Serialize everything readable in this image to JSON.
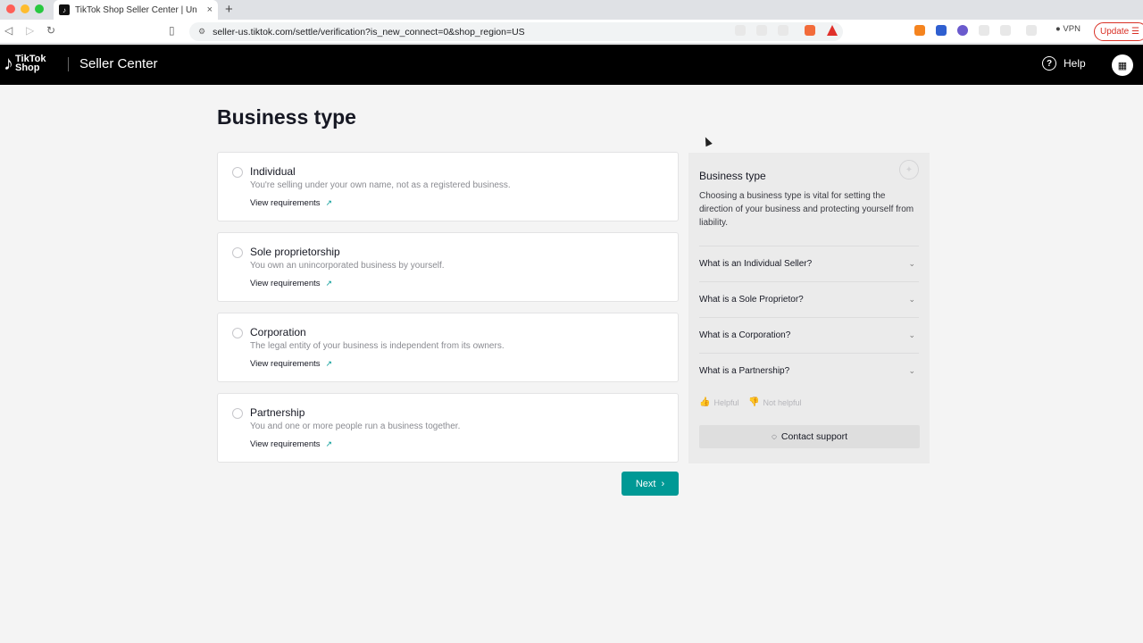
{
  "browser": {
    "tab_title": "TikTok Shop Seller Center | Un",
    "tab_close": "×",
    "new_tab": "+",
    "url": "seller-us.tiktok.com/settle/verification?is_new_connect=0&shop_region=US",
    "vpn_label": "VPN",
    "update_label": "Update",
    "favicon": "♪",
    "back_icon": "◁",
    "forward_icon": "▷",
    "reload_icon": "↻",
    "bookmark_icon": "▯",
    "url_lock_icon": "⚙",
    "vpn_dot": "●",
    "menu_icon": "☰",
    "traffic_colors": [
      "#ff5f57",
      "#febc2e",
      "#28c840"
    ]
  },
  "header": {
    "logo_note": "♪",
    "logo_line1": "TikTok",
    "logo_line2": "Shop",
    "title": "Seller Center",
    "help_icon": "?",
    "help_label": "Help",
    "store_icon": "▦"
  },
  "main": {
    "title": "Business type",
    "options": [
      {
        "title": "Individual",
        "desc": "You're selling under your own name, not as a registered business.",
        "link": "View requirements"
      },
      {
        "title": "Sole proprietorship",
        "desc": "You own an unincorporated business by yourself.",
        "link": "View requirements"
      },
      {
        "title": "Corporation",
        "desc": "The legal entity of your business is independent from its owners.",
        "link": "View requirements"
      },
      {
        "title": "Partnership",
        "desc": "You and one or more people run a business together.",
        "link": "View requirements"
      }
    ],
    "external_icon": "↗",
    "next_label": "Next",
    "next_icon": "›"
  },
  "panel": {
    "title": "Business type",
    "desc": "Choosing a business type is vital for setting the direction of your business and protecting yourself from liability.",
    "bulb_icon": "✦",
    "faqs": [
      "What is an Individual Seller?",
      "What is a Sole Proprietor?",
      "What is a Corporation?",
      "What is a Partnership?"
    ],
    "faq_chevron": "⌄",
    "helpful": "Helpful",
    "not_helpful": "Not helpful",
    "thumb_up": "👍",
    "thumb_down": "👎",
    "contact_icon": "◌",
    "contact_label": "Contact support"
  },
  "colors": {
    "accent": "#009995",
    "header_bg": "#000000",
    "page_bg": "#f4f4f4"
  }
}
